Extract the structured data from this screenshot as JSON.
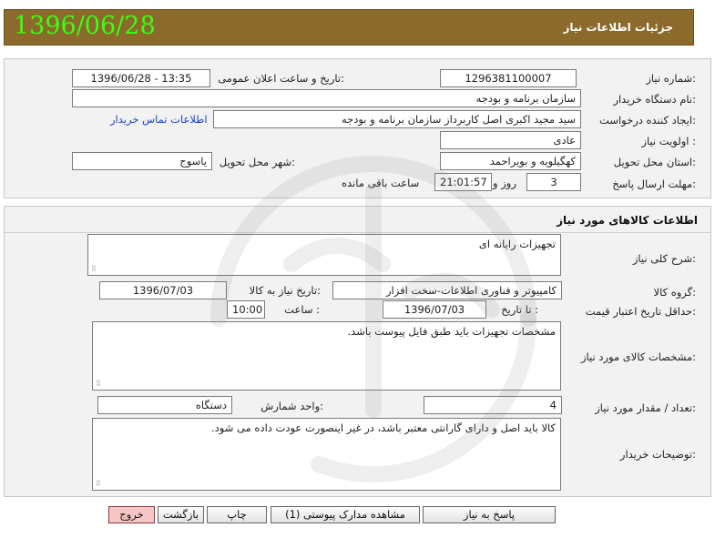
{
  "header": {
    "big_date": "1396/06/28",
    "title": "جزئیات اطلاعات نیاز"
  },
  "info": {
    "need_number_label": "شماره نیاز:",
    "need_number": "1296381100007",
    "announce_label": "تاریخ و ساعت اعلان عمومی:",
    "announce_value": "1396/06/28 - 13:35",
    "buyer_org_label": "نام دستگاه خریدار:",
    "buyer_org": "سازمان برنامه و بودجه",
    "creator_label": "ایجاد کننده درخواست:",
    "creator": "سید مجید اکبری اصل کاربرداز سازمان برنامه و بودجه",
    "contact_link": "اطلاعات تماس خریدار",
    "priority_label": "اولویت نیاز :",
    "priority": "عادی",
    "province_label": "استان محل تحویل:",
    "province": "کهگیلویه و بویراحمد",
    "city_label": "شهر محل تحویل:",
    "city": "یاسوج",
    "deadline_label": "مهلت ارسال پاسخ:",
    "deadline_days": "3",
    "days_word": "روز و",
    "deadline_time": "21:01:57",
    "remaining_word": "ساعت باقی مانده"
  },
  "goods": {
    "section_title": "اطلاعات کالاهای مورد نیاز",
    "summary_label": "شرح کلی نیاز:",
    "summary": "تجهیزات رایانه ای",
    "group_label": "گروه کالا:",
    "group": "کامپیوتر و فناوری اطلاعات-سخت افزار",
    "need_date_label": "تاریخ نیاز به کالا:",
    "need_date": "1396/07/03",
    "min_validity_label": "حداقل تاریخ اعتبار قیمت:",
    "until_label": "تا تاریخ :",
    "until_date": "1396/07/03",
    "time_label": "ساعت :",
    "time_value": "10:00",
    "spec_label": "مشخصات کالای مورد نیاز:",
    "spec": "مشخصات تجهیزات باید طبق فایل پیوست باشد.",
    "qty_label": "تعداد / مقدار مورد نیاز:",
    "qty": "4",
    "unit_label": "واحد شمارش:",
    "unit": "دستگاه",
    "buyer_notes_label": "توضیحات خریدار:",
    "buyer_notes": "کالا باید اصل و دارای گارانتی معتبر باشد، در غیر اینصورت عودت داده می شود."
  },
  "buttons": {
    "reply": "پاسخ به نیاز",
    "attachments": "مشاهده مدارک پیوستی (1)",
    "print": "چاپ",
    "back": "بازگشت",
    "exit": "خروج"
  },
  "colors": {
    "header_bg": "#8b6a2b",
    "big_date": "#39ff14",
    "link": "#1a3fd0",
    "exit_button": "#f7c6c6"
  }
}
